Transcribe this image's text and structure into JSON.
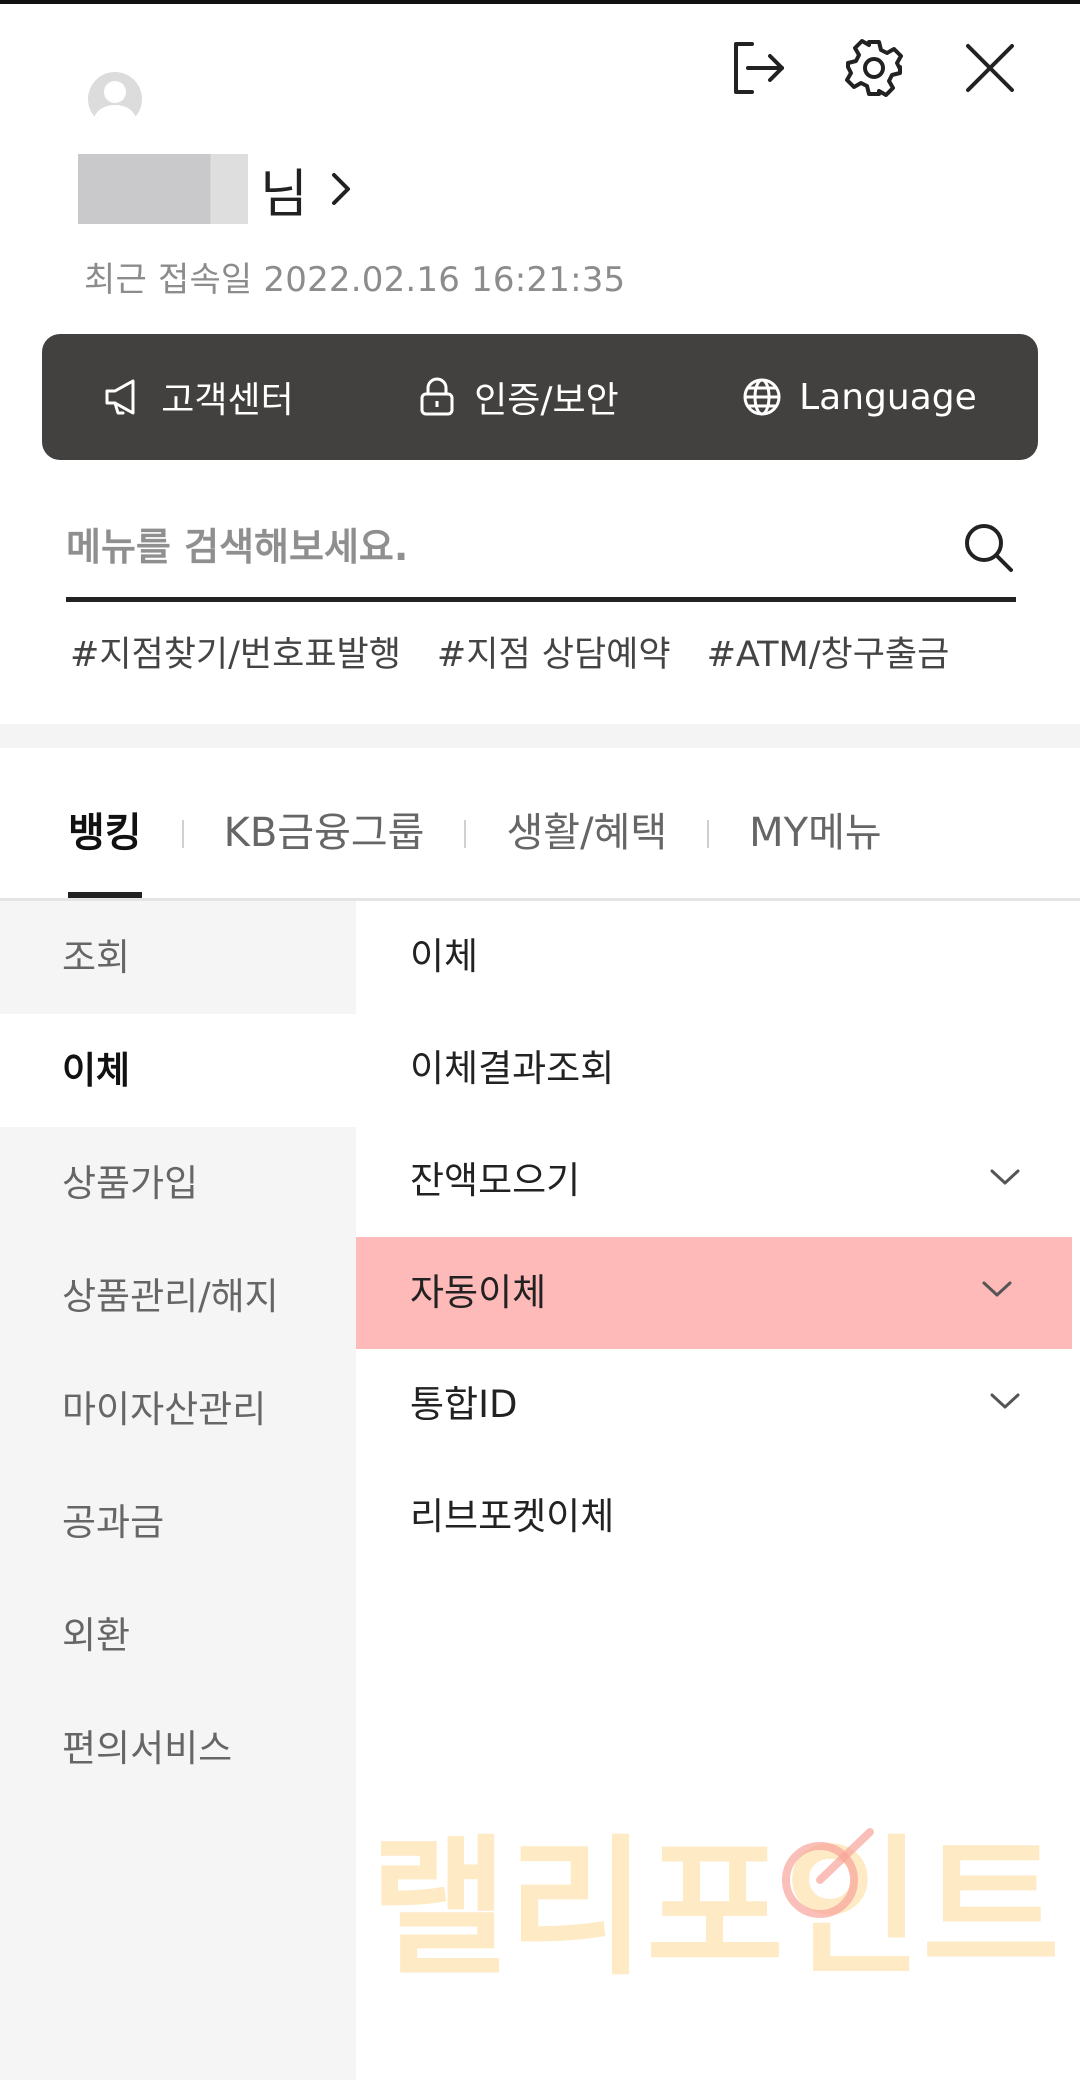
{
  "header": {
    "icons": [
      "logout-icon",
      "settings-icon",
      "close-icon"
    ]
  },
  "profile": {
    "name_suffix": "님",
    "last_login_label": "최근 접속일 2022.02.16 16:21:35"
  },
  "quickbar": {
    "items": [
      {
        "label": "고객센터",
        "icon": "megaphone-icon"
      },
      {
        "label": "인증/보안",
        "icon": "lock-icon"
      },
      {
        "label": "Language",
        "icon": "globe-icon"
      }
    ]
  },
  "search": {
    "placeholder": "메뉴를 검색해보세요.",
    "tags": [
      "#지점찾기/번호표발행",
      "#지점 상담예약",
      "#ATM/창구출금"
    ]
  },
  "tabs": [
    {
      "label": "뱅킹",
      "active": true
    },
    {
      "label": "KB금융그룹",
      "active": false
    },
    {
      "label": "생활/혜택",
      "active": false
    },
    {
      "label": "MY메뉴",
      "active": false
    }
  ],
  "leftmenu": [
    {
      "label": "조회"
    },
    {
      "label": "이체",
      "active": true
    },
    {
      "label": "상품가입"
    },
    {
      "label": "상품관리/해지"
    },
    {
      "label": "마이자산관리"
    },
    {
      "label": "공과금"
    },
    {
      "label": "외환"
    },
    {
      "label": "편의서비스"
    }
  ],
  "rightmenu": [
    {
      "label": "이체"
    },
    {
      "label": "이체결과조회"
    },
    {
      "label": "잔액모으기",
      "expandable": true
    },
    {
      "label": "자동이체",
      "expandable": true,
      "highlighted": true
    },
    {
      "label": "통합ID",
      "expandable": true
    },
    {
      "label": "리브포켓이체"
    }
  ],
  "watermark": {
    "text": "랠리포인트"
  },
  "colors": {
    "quickbar_bg": "#43413f",
    "highlight": "#feb9b9",
    "leftmenu_bg": "#f5f5f5"
  }
}
